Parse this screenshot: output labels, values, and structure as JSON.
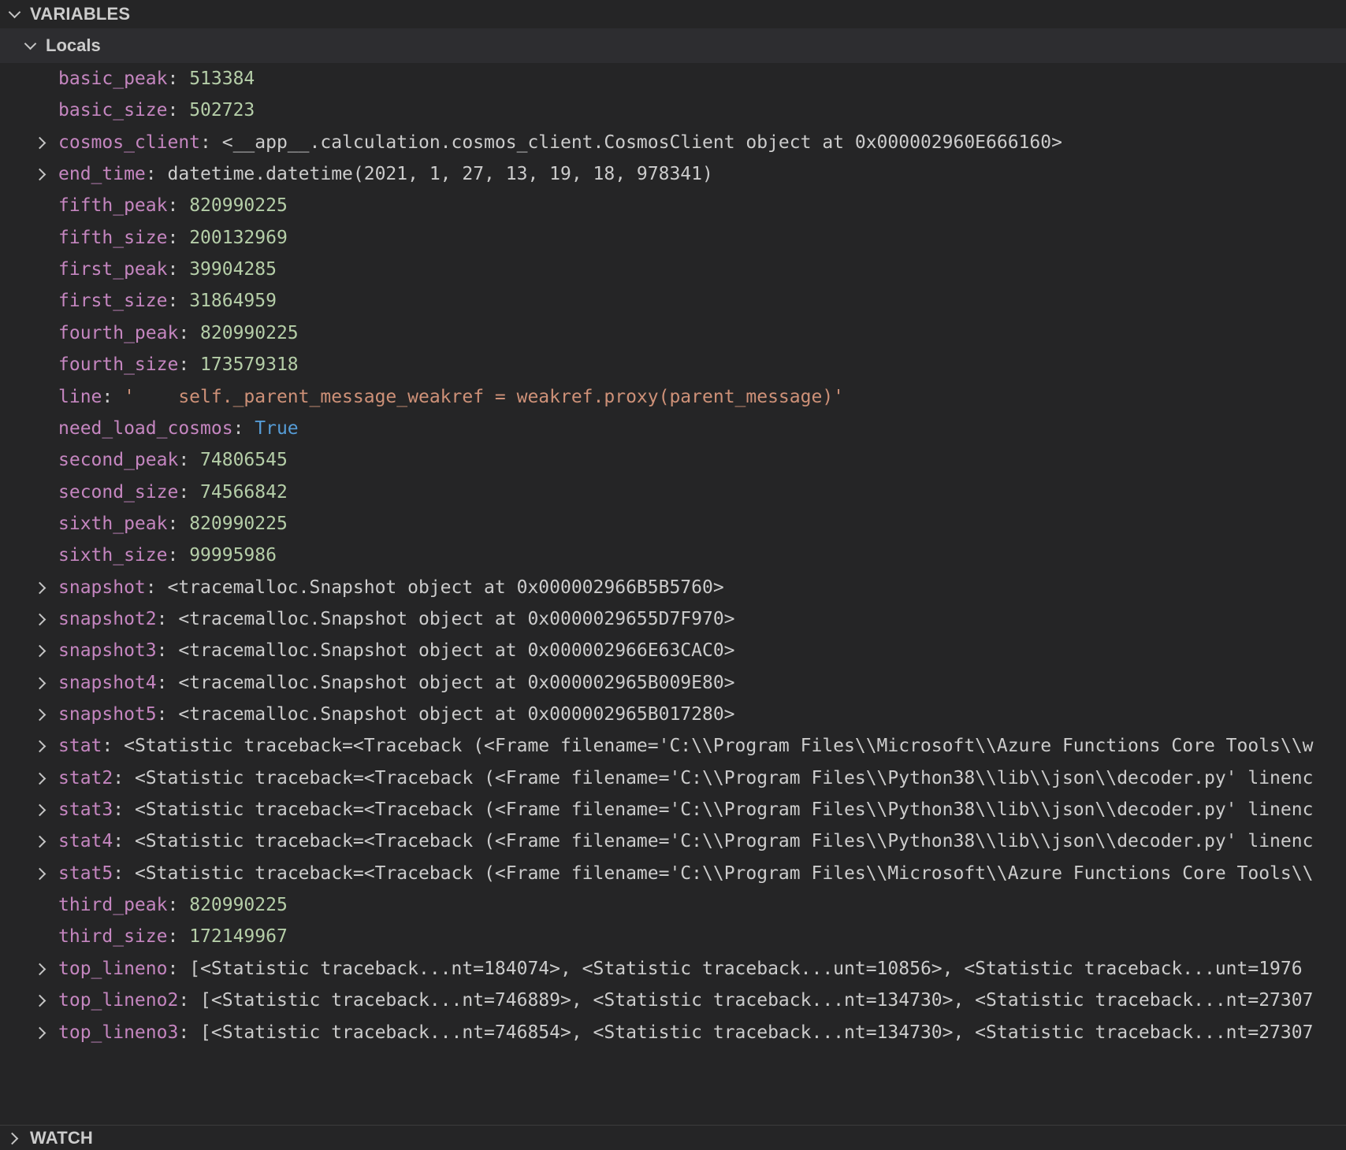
{
  "panel": {
    "variables_title": "VARIABLES",
    "watch_title": "WATCH",
    "scope_title": "Locals"
  },
  "variables": [
    {
      "name": "basic_peak",
      "value": "513384",
      "kind": "number",
      "expandable": false
    },
    {
      "name": "basic_size",
      "value": "502723",
      "kind": "number",
      "expandable": false
    },
    {
      "name": "cosmos_client",
      "value": "<__app__.calculation.cosmos_client.CosmosClient object at 0x000002960E666160>",
      "kind": "object",
      "expandable": true
    },
    {
      "name": "end_time",
      "value": "datetime.datetime(2021, 1, 27, 13, 19, 18, 978341)",
      "kind": "object",
      "expandable": true
    },
    {
      "name": "fifth_peak",
      "value": "820990225",
      "kind": "number",
      "expandable": false
    },
    {
      "name": "fifth_size",
      "value": "200132969",
      "kind": "number",
      "expandable": false
    },
    {
      "name": "first_peak",
      "value": "39904285",
      "kind": "number",
      "expandable": false
    },
    {
      "name": "first_size",
      "value": "31864959",
      "kind": "number",
      "expandable": false
    },
    {
      "name": "fourth_peak",
      "value": "820990225",
      "kind": "number",
      "expandable": false
    },
    {
      "name": "fourth_size",
      "value": "173579318",
      "kind": "number",
      "expandable": false
    },
    {
      "name": "line",
      "value": "'    self._parent_message_weakref = weakref.proxy(parent_message)'",
      "kind": "string",
      "expandable": false
    },
    {
      "name": "need_load_cosmos",
      "value": "True",
      "kind": "bool",
      "expandable": false
    },
    {
      "name": "second_peak",
      "value": "74806545",
      "kind": "number",
      "expandable": false
    },
    {
      "name": "second_size",
      "value": "74566842",
      "kind": "number",
      "expandable": false
    },
    {
      "name": "sixth_peak",
      "value": "820990225",
      "kind": "number",
      "expandable": false
    },
    {
      "name": "sixth_size",
      "value": "99995986",
      "kind": "number",
      "expandable": false
    },
    {
      "name": "snapshot",
      "value": "<tracemalloc.Snapshot object at 0x000002966B5B5760>",
      "kind": "object",
      "expandable": true
    },
    {
      "name": "snapshot2",
      "value": "<tracemalloc.Snapshot object at 0x0000029655D7F970>",
      "kind": "object",
      "expandable": true
    },
    {
      "name": "snapshot3",
      "value": "<tracemalloc.Snapshot object at 0x000002966E63CAC0>",
      "kind": "object",
      "expandable": true
    },
    {
      "name": "snapshot4",
      "value": "<tracemalloc.Snapshot object at 0x000002965B009E80>",
      "kind": "object",
      "expandable": true
    },
    {
      "name": "snapshot5",
      "value": "<tracemalloc.Snapshot object at 0x000002965B017280>",
      "kind": "object",
      "expandable": true
    },
    {
      "name": "stat",
      "value": "<Statistic traceback=<Traceback (<Frame filename='C:\\\\Program Files\\\\Microsoft\\\\Azure Functions Core Tools\\\\w",
      "kind": "object",
      "expandable": true
    },
    {
      "name": "stat2",
      "value": "<Statistic traceback=<Traceback (<Frame filename='C:\\\\Program Files\\\\Python38\\\\lib\\\\json\\\\decoder.py' linenc",
      "kind": "object",
      "expandable": true
    },
    {
      "name": "stat3",
      "value": "<Statistic traceback=<Traceback (<Frame filename='C:\\\\Program Files\\\\Python38\\\\lib\\\\json\\\\decoder.py' linenc",
      "kind": "object",
      "expandable": true
    },
    {
      "name": "stat4",
      "value": "<Statistic traceback=<Traceback (<Frame filename='C:\\\\Program Files\\\\Python38\\\\lib\\\\json\\\\decoder.py' linenc",
      "kind": "object",
      "expandable": true
    },
    {
      "name": "stat5",
      "value": "<Statistic traceback=<Traceback (<Frame filename='C:\\\\Program Files\\\\Microsoft\\\\Azure Functions Core Tools\\\\",
      "kind": "object",
      "expandable": true
    },
    {
      "name": "third_peak",
      "value": "820990225",
      "kind": "number",
      "expandable": false
    },
    {
      "name": "third_size",
      "value": "172149967",
      "kind": "number",
      "expandable": false
    },
    {
      "name": "top_lineno",
      "value": "[<Statistic traceback...nt=184074>, <Statistic traceback...unt=10856>, <Statistic traceback...unt=1976",
      "kind": "object",
      "expandable": true
    },
    {
      "name": "top_lineno2",
      "value": "[<Statistic traceback...nt=746889>, <Statistic traceback...nt=134730>, <Statistic traceback...nt=27307",
      "kind": "object",
      "expandable": true
    },
    {
      "name": "top_lineno3",
      "value": "[<Statistic traceback...nt=746854>, <Statistic traceback...nt=134730>, <Statistic traceback...nt=27307",
      "kind": "object",
      "expandable": true
    }
  ]
}
